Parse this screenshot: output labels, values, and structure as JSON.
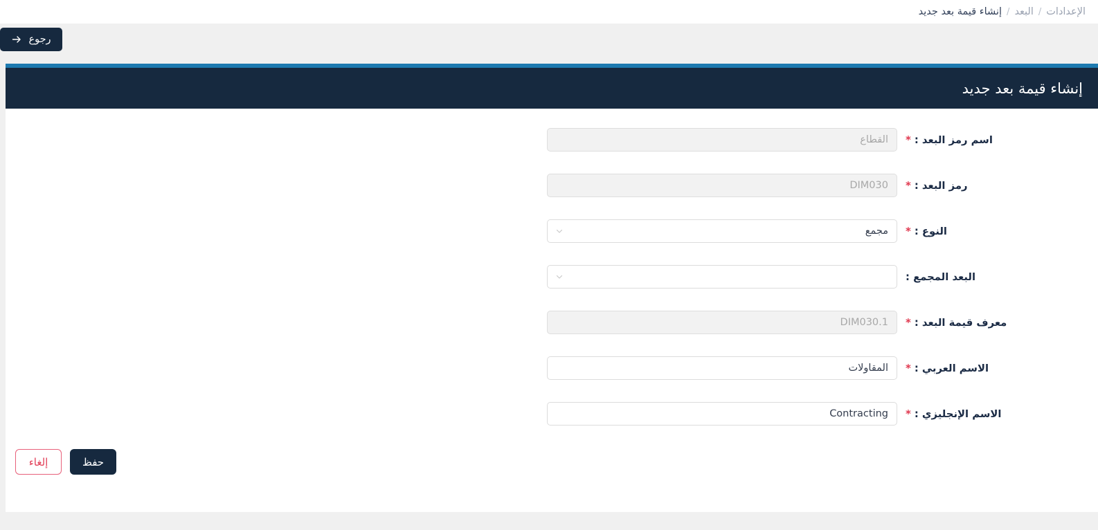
{
  "breadcrumb": {
    "items": [
      {
        "label": "الإعدادات",
        "current": false
      },
      {
        "label": "البعد",
        "current": false
      },
      {
        "label": "إنشاء قيمة بعد جديد",
        "current": true
      }
    ],
    "separator": "/"
  },
  "toolbar": {
    "back_label": "رجوع",
    "back_icon": "arrow-right-icon"
  },
  "header": {
    "title": "إنشاء قيمة بعد جديد"
  },
  "colors": {
    "accent_blue": "#1d7ab0",
    "header_navy": "#16293f",
    "required_red": "#e0384f",
    "cancel_red": "#e23e57",
    "page_background": "#f0f0f0",
    "readonly_field": "#f2f2f2"
  },
  "form": {
    "rows": [
      {
        "key": "dimension_code_name",
        "label": "اسم رمز البعد :",
        "required": true,
        "control": "text",
        "value": "القطاع",
        "placeholder": "",
        "readonly": true,
        "ltr": false
      },
      {
        "key": "dimension_code",
        "label": "رمز البعد :",
        "required": true,
        "control": "text",
        "value": "DIM030",
        "placeholder": "",
        "readonly": true,
        "ltr": true
      },
      {
        "key": "type",
        "label": "النوع :",
        "required": true,
        "control": "select",
        "value": "مجمع",
        "placeholder": "",
        "readonly": false,
        "icon": "chevron-down-icon"
      },
      {
        "key": "parent_dimension",
        "label": "البعد المجمع :",
        "required": false,
        "control": "select",
        "value": "",
        "placeholder": "",
        "readonly": false,
        "icon": "chevron-down-icon"
      },
      {
        "key": "dimension_value_id",
        "label": "معرف قيمة البعد :",
        "required": true,
        "control": "text",
        "value": "DIM030.1",
        "placeholder": "",
        "readonly": true,
        "ltr": true
      },
      {
        "key": "arabic_name",
        "label": "الاسم العربي :",
        "required": true,
        "control": "text",
        "value": "المقاولات",
        "placeholder": "",
        "readonly": false,
        "ltr": false
      },
      {
        "key": "english_name",
        "label": "الاسم الإنجليزي :",
        "required": true,
        "control": "text",
        "value": "Contracting",
        "placeholder": "",
        "readonly": false,
        "ltr": true
      }
    ]
  },
  "footer": {
    "save_label": "حفظ",
    "cancel_label": "إلغاء"
  }
}
